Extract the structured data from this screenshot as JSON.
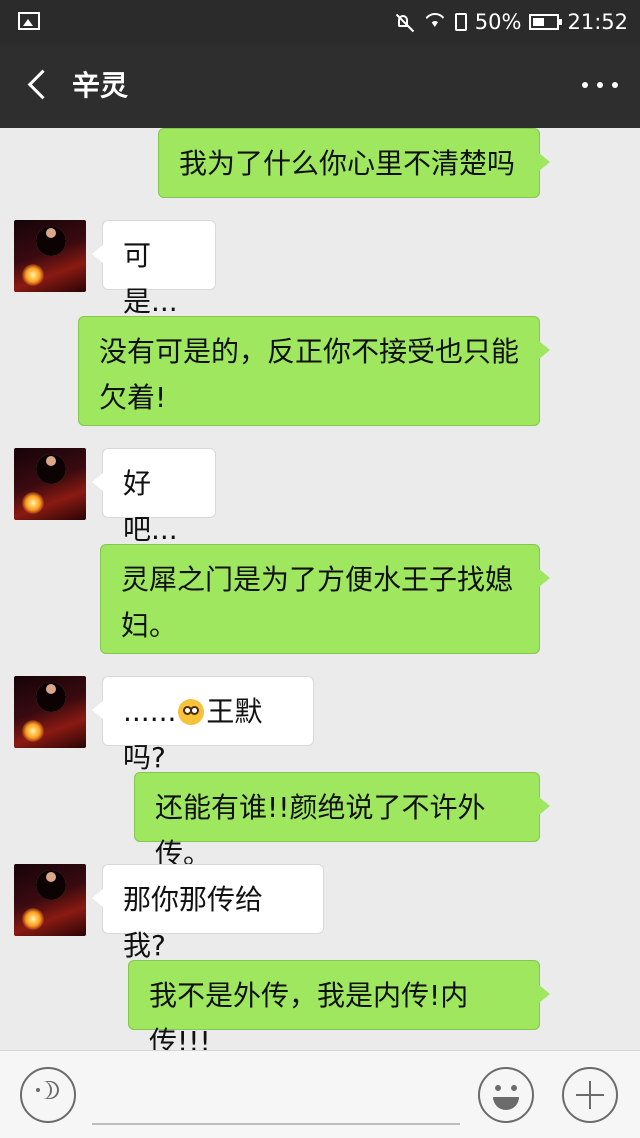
{
  "status_bar": {
    "battery_percent": "50%",
    "time": "21:52",
    "icons": [
      "gallery-icon",
      "mute-icon",
      "wifi-icon",
      "sim-icon",
      "battery-icon"
    ]
  },
  "header": {
    "title": "辛灵",
    "back_icon": "chevron-left-icon",
    "more_icon": "more-dots-icon"
  },
  "colors": {
    "outgoing_bubble": "#9fe75f",
    "incoming_bubble": "#ffffff",
    "chat_background": "#ebebeb",
    "header_background": "#2e2e2e"
  },
  "messages": [
    {
      "sender": "me",
      "text": "我为了什么你心里不清楚吗"
    },
    {
      "sender": "contact",
      "text": "可是..."
    },
    {
      "sender": "me",
      "text": "没有可是的，反正你不接受也只能欠着!"
    },
    {
      "sender": "contact",
      "text": "好吧..."
    },
    {
      "sender": "me",
      "text": "灵犀之门是为了方便水王子找媳妇。"
    },
    {
      "sender": "contact",
      "text_before_emoji": "......",
      "emoji": "flushed-face-emoji",
      "text_after_emoji": "王默吗?"
    },
    {
      "sender": "me",
      "text": "还能有谁!!颜绝说了不许外传。"
    },
    {
      "sender": "contact",
      "text": "那你那传给我?"
    },
    {
      "sender": "me",
      "text": "我不是外传，我是内传!内传!!!"
    }
  ],
  "input_bar": {
    "placeholder": "",
    "voice_icon": "voice-icon",
    "emoji_icon": "emoji-icon",
    "plus_icon": "plus-icon"
  }
}
